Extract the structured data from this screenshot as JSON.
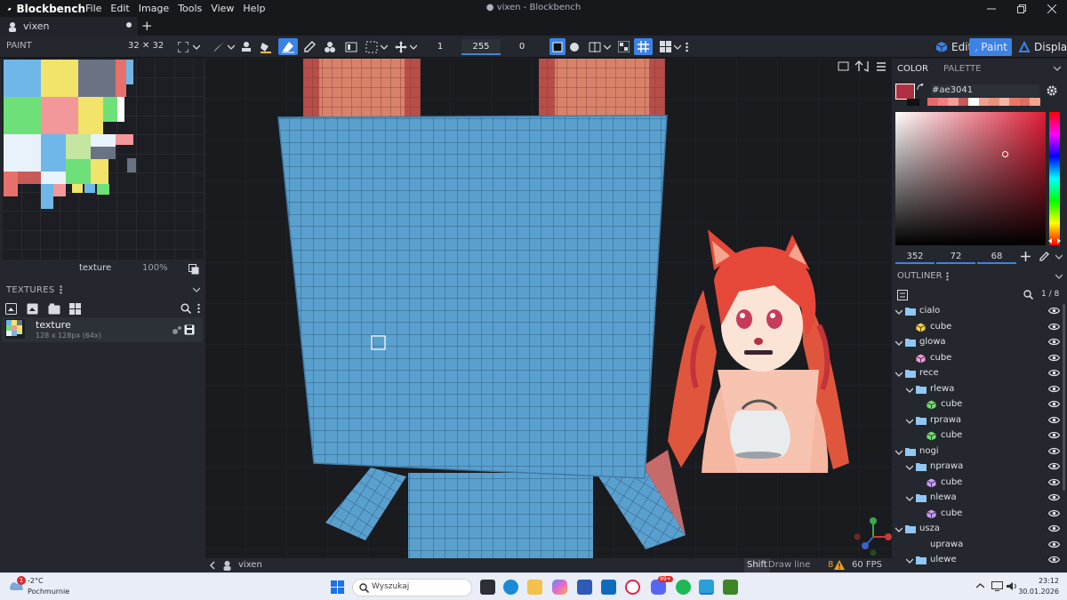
{
  "app": {
    "name": "Blockbench",
    "window_title": "● vixen - Blockbench",
    "menu": [
      "File",
      "Edit",
      "Image",
      "Tools",
      "View",
      "Help"
    ],
    "tab_name": "vixen"
  },
  "toolbar": {
    "panel_title": "PAINT",
    "texture_size": "32 ✕ 32",
    "brush_size": "1",
    "opacity": "255",
    "softness": "0",
    "modes": {
      "edit": "Edit",
      "paint": "Paint",
      "display": "Display"
    },
    "active_mode": "Paint"
  },
  "left_panel": {
    "uv_texture_name": "texture",
    "uv_zoom": "100%",
    "textures_title": "TEXTURES",
    "texture_item": {
      "name": "texture",
      "details": "128 x 128px (64x)"
    }
  },
  "viewport": {
    "status_model": "vixen",
    "status_key": "Shift",
    "status_hint": "Draw line",
    "warnings": "8",
    "fps": "60 FPS",
    "cube_color": "#5aa0cf"
  },
  "color_panel": {
    "tab_color": "COLOR",
    "tab_palette": "PALETTE",
    "hex": "#ae3041",
    "selected_color": "#ae3041",
    "h": "352",
    "s": "72",
    "v": "68",
    "recent_colors": [
      "#e8696b",
      "#ee8080",
      "#f49c98",
      "#c85a58",
      "#ffffff",
      "#f0a090",
      "#e8927a",
      "#f5b6a4",
      "#e87864",
      "#d97060",
      "#f2a48c"
    ]
  },
  "outliner": {
    "title": "OUTLINER",
    "count": "1 / 8",
    "items": [
      {
        "label": "cialo",
        "type": "folder",
        "depth": 0
      },
      {
        "label": "cube",
        "type": "cube",
        "depth": 1,
        "color": "#f4d03f"
      },
      {
        "label": "glowa",
        "type": "folder",
        "depth": 0
      },
      {
        "label": "cube",
        "type": "cube",
        "depth": 1,
        "color": "#f39ad6"
      },
      {
        "label": "rece",
        "type": "folder",
        "depth": 0
      },
      {
        "label": "rlewa",
        "type": "folder",
        "depth": 1
      },
      {
        "label": "cube",
        "type": "cube",
        "depth": 2,
        "color": "#6ee06e"
      },
      {
        "label": "rprawa",
        "type": "folder",
        "depth": 1
      },
      {
        "label": "cube",
        "type": "cube",
        "depth": 2,
        "color": "#6ee06e"
      },
      {
        "label": "nogi",
        "type": "folder",
        "depth": 0
      },
      {
        "label": "nprawa",
        "type": "folder",
        "depth": 1
      },
      {
        "label": "cube",
        "type": "cube",
        "depth": 2,
        "color": "#c99af2"
      },
      {
        "label": "nlewa",
        "type": "folder",
        "depth": 1
      },
      {
        "label": "cube",
        "type": "cube",
        "depth": 2,
        "color": "#c99af2"
      },
      {
        "label": "usza",
        "type": "folder",
        "depth": 0
      },
      {
        "label": "uprawa",
        "type": "item",
        "depth": 1
      },
      {
        "label": "ulewe",
        "type": "folder",
        "depth": 1
      }
    ]
  },
  "taskbar": {
    "temperature": "-2°C",
    "weather": "Pochmurnie",
    "weather_badge": "1",
    "search_placeholder": "Wyszukaj",
    "time": "23:12",
    "date": "30.01.2026",
    "badge_count": "99+"
  }
}
